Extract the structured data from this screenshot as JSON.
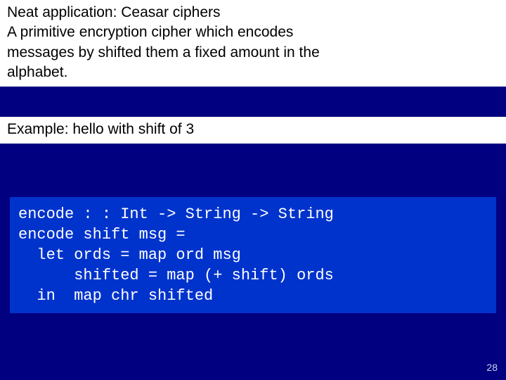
{
  "intro": {
    "line1": "Neat application: Ceasar ciphers",
    "line2": "A primitive encryption cipher which encodes",
    "line3": "messages by shifted them a fixed amount in the",
    "line4": "alphabet."
  },
  "example": "Example: hello with shift of 3",
  "code": {
    "l1": "encode : : Int -> String -> String",
    "l2": "encode shift msg =",
    "l3": "  let ords = map ord msg",
    "l4": "      shifted = map (+ shift) ords",
    "l5": "  in  map chr shifted"
  },
  "page_number": "28"
}
